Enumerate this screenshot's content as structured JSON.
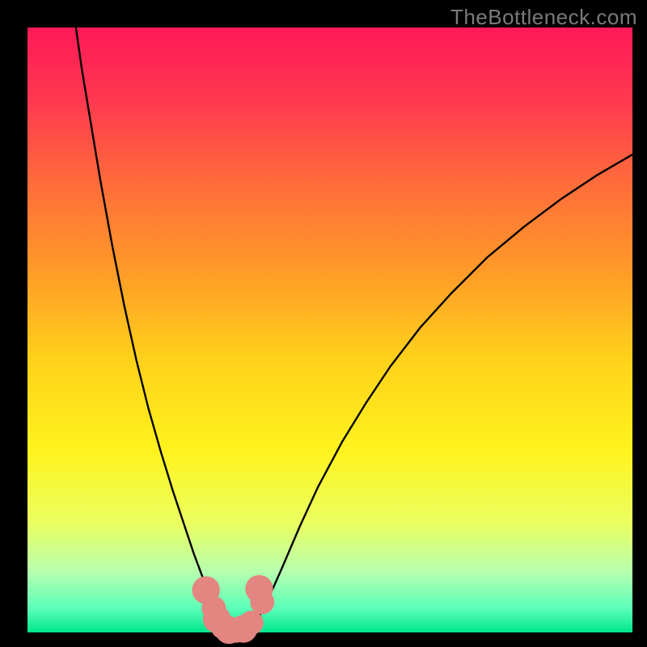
{
  "watermark": "TheBottleneck.com",
  "chart_data": {
    "type": "line",
    "title": "",
    "xlabel": "",
    "ylabel": "",
    "xlim": [
      0,
      100
    ],
    "ylim": [
      0,
      100
    ],
    "background_gradient": {
      "stops": [
        {
          "offset": 0.0,
          "color": "#ff1a58"
        },
        {
          "offset": 0.12,
          "color": "#ff3850"
        },
        {
          "offset": 0.26,
          "color": "#ff6d3a"
        },
        {
          "offset": 0.4,
          "color": "#ff9a28"
        },
        {
          "offset": 0.55,
          "color": "#ffd21a"
        },
        {
          "offset": 0.7,
          "color": "#fff31e"
        },
        {
          "offset": 0.82,
          "color": "#eaff60"
        },
        {
          "offset": 0.9,
          "color": "#b6ffb0"
        },
        {
          "offset": 0.96,
          "color": "#5cffb8"
        },
        {
          "offset": 1.0,
          "color": "#00e68c"
        }
      ]
    },
    "series": [
      {
        "name": "bottleneck-left",
        "stroke": "#000000",
        "stroke_width": 2.4,
        "points": [
          {
            "x": 8.0,
            "y": 100.0
          },
          {
            "x": 9.0,
            "y": 93.0
          },
          {
            "x": 10.5,
            "y": 84.0
          },
          {
            "x": 12.0,
            "y": 75.0
          },
          {
            "x": 14.0,
            "y": 64.0
          },
          {
            "x": 16.0,
            "y": 54.0
          },
          {
            "x": 18.0,
            "y": 45.0
          },
          {
            "x": 20.0,
            "y": 37.0
          },
          {
            "x": 22.0,
            "y": 30.0
          },
          {
            "x": 24.0,
            "y": 23.5
          },
          {
            "x": 26.0,
            "y": 17.5
          },
          {
            "x": 27.5,
            "y": 13.0
          },
          {
            "x": 29.0,
            "y": 9.0
          },
          {
            "x": 30.2,
            "y": 5.5
          },
          {
            "x": 31.2,
            "y": 3.0
          },
          {
            "x": 32.0,
            "y": 1.5
          },
          {
            "x": 33.0,
            "y": 0.6
          },
          {
            "x": 34.0,
            "y": 0.2
          }
        ]
      },
      {
        "name": "bottleneck-right",
        "stroke": "#000000",
        "stroke_width": 2.4,
        "points": [
          {
            "x": 34.0,
            "y": 0.2
          },
          {
            "x": 35.5,
            "y": 0.4
          },
          {
            "x": 37.0,
            "y": 1.2
          },
          {
            "x": 38.5,
            "y": 3.0
          },
          {
            "x": 40.0,
            "y": 6.0
          },
          {
            "x": 42.0,
            "y": 10.5
          },
          {
            "x": 45.0,
            "y": 17.5
          },
          {
            "x": 48.0,
            "y": 24.0
          },
          {
            "x": 52.0,
            "y": 31.5
          },
          {
            "x": 56.0,
            "y": 38.0
          },
          {
            "x": 60.0,
            "y": 44.0
          },
          {
            "x": 65.0,
            "y": 50.5
          },
          {
            "x": 70.0,
            "y": 56.0
          },
          {
            "x": 76.0,
            "y": 62.0
          },
          {
            "x": 82.0,
            "y": 67.0
          },
          {
            "x": 88.0,
            "y": 71.5
          },
          {
            "x": 94.0,
            "y": 75.5
          },
          {
            "x": 100.0,
            "y": 79.0
          }
        ]
      }
    ],
    "markers": {
      "name": "highlight-points",
      "fill": "#e38580",
      "points": [
        {
          "x": 29.5,
          "y": 7.0,
          "r": 2.3
        },
        {
          "x": 30.8,
          "y": 4.0,
          "r": 2.0
        },
        {
          "x": 31.3,
          "y": 2.2,
          "r": 2.3
        },
        {
          "x": 32.3,
          "y": 0.9,
          "r": 2.0
        },
        {
          "x": 33.3,
          "y": 0.4,
          "r": 2.3
        },
        {
          "x": 34.5,
          "y": 0.3,
          "r": 2.0
        },
        {
          "x": 35.7,
          "y": 0.6,
          "r": 2.3
        },
        {
          "x": 37.0,
          "y": 1.6,
          "r": 2.0
        },
        {
          "x": 38.3,
          "y": 7.2,
          "r": 2.3
        },
        {
          "x": 38.8,
          "y": 5.0,
          "r": 2.0
        }
      ]
    }
  }
}
